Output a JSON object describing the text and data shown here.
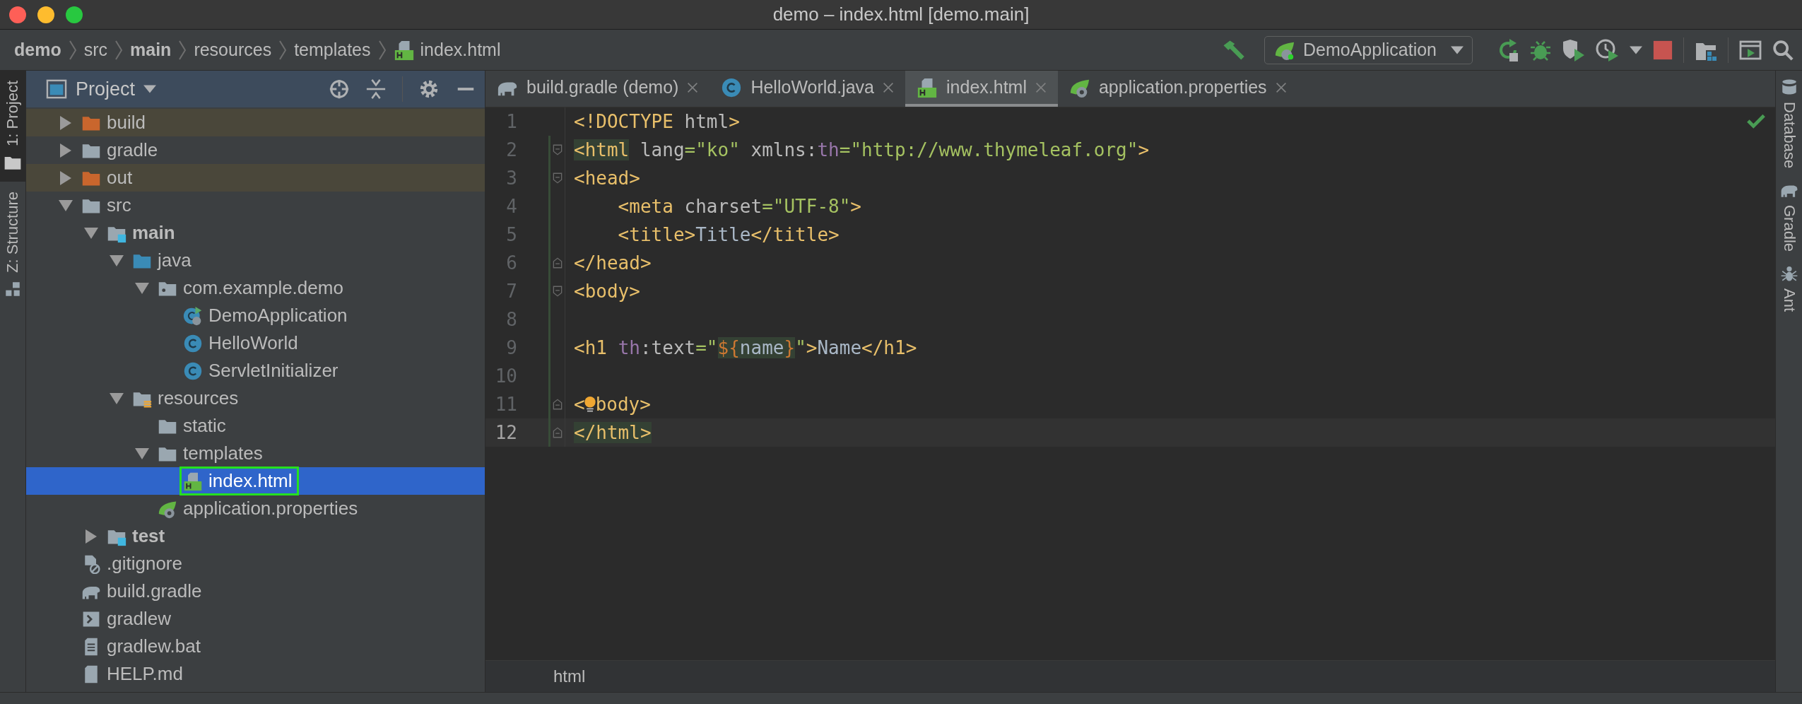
{
  "window": {
    "title": "demo – index.html [demo.main]"
  },
  "nav_bar": {
    "breadcrumbs": [
      {
        "label": "demo",
        "kind": "module"
      },
      {
        "label": "src",
        "kind": "folder"
      },
      {
        "label": "main",
        "kind": "module"
      },
      {
        "label": "resources",
        "kind": "folder"
      },
      {
        "label": "templates",
        "kind": "folder"
      },
      {
        "label": "index.html",
        "kind": "html"
      }
    ],
    "run_config": "DemoApplication"
  },
  "left_strip": [
    {
      "label": "1: Project",
      "kind": "project",
      "selected": true
    },
    {
      "label": "Z: Structure",
      "kind": "structure",
      "selected": false
    }
  ],
  "right_strip": [
    {
      "label": "Database",
      "kind": "database"
    },
    {
      "label": "Gradle",
      "kind": "gradle"
    },
    {
      "label": "Ant",
      "kind": "ant"
    }
  ],
  "project_panel": {
    "title": "Project",
    "tree": [
      {
        "label": "build",
        "kind": "excluded-folder",
        "expanded": false,
        "ignored": true,
        "selected": false
      },
      {
        "label": "gradle",
        "kind": "folder",
        "expanded": false,
        "ignored": false,
        "selected": false
      },
      {
        "label": "out",
        "kind": "excluded-folder",
        "expanded": false,
        "ignored": true,
        "selected": false
      },
      {
        "label": "src",
        "kind": "folder",
        "expanded": true,
        "ignored": false,
        "selected": false,
        "children": [
          {
            "label": "main",
            "kind": "module-root",
            "expanded": true,
            "selected": false,
            "children": [
              {
                "label": "java",
                "kind": "java-root",
                "expanded": true,
                "selected": false,
                "children": [
                  {
                    "label": "com.example.demo",
                    "kind": "package",
                    "expanded": true,
                    "selected": false,
                    "children": [
                      {
                        "label": "DemoApplication",
                        "kind": "spring-class",
                        "selected": false
                      },
                      {
                        "label": "HelloWorld",
                        "kind": "class",
                        "selected": false
                      },
                      {
                        "label": "ServletInitializer",
                        "kind": "class",
                        "selected": false
                      }
                    ]
                  }
                ]
              },
              {
                "label": "resources",
                "kind": "resources-root",
                "expanded": true,
                "selected": false,
                "children": [
                  {
                    "label": "static",
                    "kind": "folder",
                    "selected": false
                  },
                  {
                    "label": "templates",
                    "kind": "folder",
                    "expanded": true,
                    "selected": false,
                    "children": [
                      {
                        "label": "index.html",
                        "kind": "html",
                        "selected": true,
                        "outlined": true
                      }
                    ]
                  },
                  {
                    "label": "application.properties",
                    "kind": "spring-file",
                    "selected": false
                  }
                ]
              }
            ]
          },
          {
            "label": "test",
            "kind": "module-root",
            "expanded": false,
            "selected": false
          }
        ]
      },
      {
        "label": ".gitignore",
        "kind": "gitignore",
        "ignored": false,
        "selected": false
      },
      {
        "label": "build.gradle",
        "kind": "gradle",
        "ignored": false,
        "selected": false
      },
      {
        "label": "gradlew",
        "kind": "shell",
        "ignored": false,
        "selected": false
      },
      {
        "label": "gradlew.bat",
        "kind": "text-file",
        "ignored": false,
        "selected": false
      },
      {
        "label": "HELP.md",
        "kind": "md",
        "ignored": false,
        "selected": false
      }
    ]
  },
  "editor": {
    "tabs": [
      {
        "label": "build.gradle (demo)",
        "kind": "gradle",
        "selected": false
      },
      {
        "label": "HelloWorld.java",
        "kind": "class",
        "selected": false
      },
      {
        "label": "index.html",
        "kind": "html",
        "selected": true
      },
      {
        "label": "application.properties",
        "kind": "spring-file",
        "selected": false
      }
    ],
    "lines": [
      {
        "number": "1",
        "changed": false,
        "current": false,
        "tokens": [
          {
            "kind": "tag",
            "t": "<!DOCTYPE "
          },
          {
            "kind": "attr",
            "t": "html"
          },
          {
            "kind": "tag",
            "t": ">"
          }
        ]
      },
      {
        "number": "2",
        "changed": true,
        "current": false,
        "fold_start": true,
        "tokens": [
          {
            "kind": "tag",
            "t": "<html",
            "hl": true
          },
          {
            "kind": "attr",
            "t": " lang"
          },
          {
            "kind": "value",
            "t": "=\"ko\""
          },
          {
            "kind": "attr",
            "t": " xmlns:"
          },
          {
            "kind": "ns",
            "t": "th"
          },
          {
            "kind": "value",
            "t": "=\"http://www.thymeleaf.org\""
          },
          {
            "kind": "tag",
            "t": ">"
          }
        ]
      },
      {
        "number": "3",
        "changed": true,
        "current": false,
        "fold_start": true,
        "tokens": [
          {
            "kind": "tag",
            "t": "<head>"
          }
        ]
      },
      {
        "number": "4",
        "changed": true,
        "current": false,
        "tokens": [
          {
            "kind": "tag",
            "t": "    <meta "
          },
          {
            "kind": "attr",
            "t": "charset"
          },
          {
            "kind": "value",
            "t": "=\"UTF-8\""
          },
          {
            "kind": "tag",
            "t": ">"
          }
        ]
      },
      {
        "number": "5",
        "changed": true,
        "current": false,
        "tokens": [
          {
            "kind": "tag",
            "t": "    <title>"
          },
          {
            "kind": "text",
            "t": "Title"
          },
          {
            "kind": "tag",
            "t": "</title>"
          }
        ]
      },
      {
        "number": "6",
        "changed": true,
        "current": false,
        "fold_end": true,
        "tokens": [
          {
            "kind": "tag",
            "t": "</head>"
          }
        ]
      },
      {
        "number": "7",
        "changed": true,
        "current": false,
        "fold_start": true,
        "tokens": [
          {
            "kind": "tag",
            "t": "<body>"
          }
        ]
      },
      {
        "number": "8",
        "changed": true,
        "current": false
      },
      {
        "number": "9",
        "changed": true,
        "current": false,
        "tokens": [
          {
            "kind": "tag",
            "t": "<h1 "
          },
          {
            "kind": "ns",
            "t": "th"
          },
          {
            "kind": "attr",
            "t": ":text"
          },
          {
            "kind": "value",
            "t": "=\""
          },
          {
            "kind": "expr",
            "t": "${",
            "hl": true
          },
          {
            "kind": "text",
            "t": "name",
            "hl": true
          },
          {
            "kind": "expr",
            "t": "}",
            "hl": true
          },
          {
            "kind": "value",
            "t": "\""
          },
          {
            "kind": "tag",
            "t": ">"
          },
          {
            "kind": "text",
            "t": "Name"
          },
          {
            "kind": "tag",
            "t": "</h1>"
          }
        ]
      },
      {
        "number": "10",
        "changed": true,
        "current": false
      },
      {
        "number": "11",
        "changed": true,
        "current": false,
        "fold_end": true,
        "bulb": true,
        "tokens": [
          {
            "kind": "tag",
            "t": "<"
          },
          {
            "kind": "tag",
            "t": "body>"
          }
        ]
      },
      {
        "number": "12",
        "changed": true,
        "current": true,
        "fold_end": true,
        "tokens": [
          {
            "kind": "tag",
            "t": "</html>",
            "hl": true
          }
        ]
      }
    ],
    "breadcrumb": "html"
  }
}
